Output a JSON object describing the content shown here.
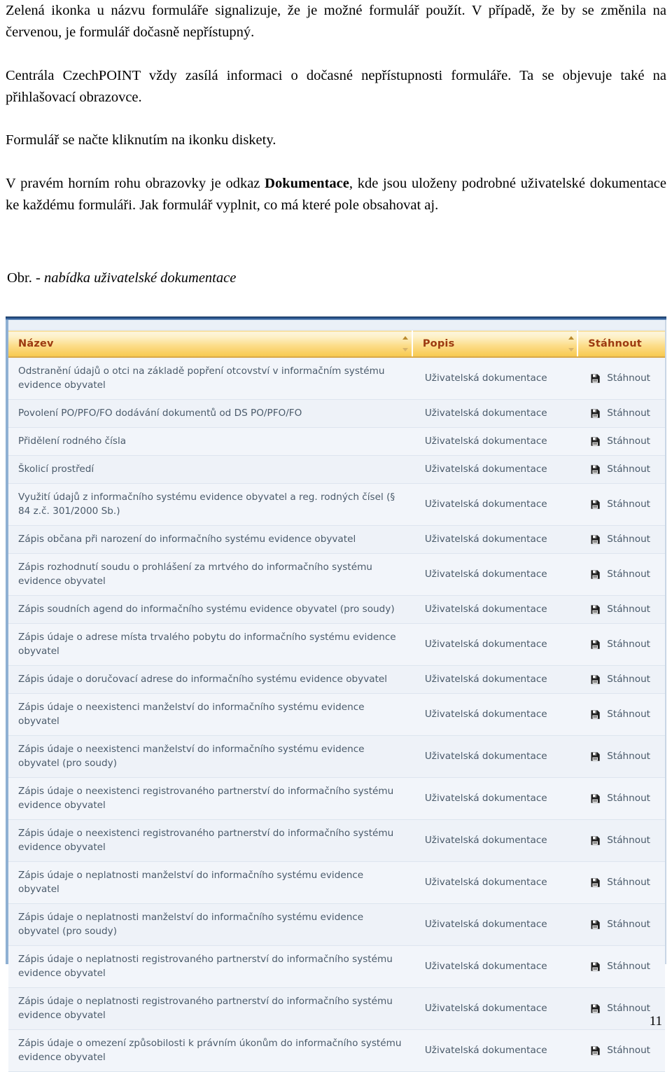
{
  "document": {
    "page_number": "11",
    "paragraphs": [
      "Zelená ikonka u názvu formuláře signalizuje, že je možné formulář použít. V případě, že by se změnila na červenou, je formulář dočasně nepřístupný.",
      "Centrála CzechPOINT vždy zasílá informaci o dočasné nepřístupnosti formuláře. Ta se objevuje také na přihlašovací obrazovce.",
      "Formulář se načte kliknutím na ikonku diskety."
    ],
    "paragraph_4": {
      "before": "V pravém horním rohu obrazovky je odkaz ",
      "bold": "Dokumentace",
      "after": ", kde jsou uloženy podrobné uživatelské dokumentace ke každému formuláři. Jak formulář vyplnit, co má které pole obsahovat aj."
    },
    "figure_caption": {
      "label": "Obr. ",
      "italic": "- nabídka uživatelské dokumentace"
    }
  },
  "screenshot": {
    "table": {
      "columns": [
        {
          "key": "name",
          "label": "Název",
          "sortable": true
        },
        {
          "key": "desc",
          "label": "Popis",
          "sortable": true
        },
        {
          "key": "download",
          "label": "Stáhnout",
          "sortable": false
        }
      ],
      "download_label": "Stáhnout",
      "download_icon": "floppy-disk-icon",
      "rows": [
        {
          "name": "Odstranění údajů o otci na základě popření otcovství v informačním systému evidence obyvatel",
          "desc": "Uživatelská dokumentace",
          "download": "Stáhnout"
        },
        {
          "name": "Povolení PO/PFO/FO dodávání dokumentů od DS PO/PFO/FO",
          "desc": "Uživatelská dokumentace",
          "download": "Stáhnout"
        },
        {
          "name": "Přidělení rodného čísla",
          "desc": "Uživatelská dokumentace",
          "download": "Stáhnout"
        },
        {
          "name": "Školicí prostředí",
          "desc": "Uživatelská dokumentace",
          "download": "Stáhnout"
        },
        {
          "name": "Využití údajů z informačního systému evidence obyvatel a reg. rodných čísel (§ 84 z.č. 301/2000 Sb.)",
          "desc": "Uživatelská dokumentace",
          "download": "Stáhnout"
        },
        {
          "name": "Zápis občana při narození do informačního systému evidence obyvatel",
          "desc": "Uživatelská dokumentace",
          "download": "Stáhnout"
        },
        {
          "name": "Zápis rozhodnutí soudu o prohlášení za mrtvého do informačního systému evidence obyvatel",
          "desc": "Uživatelská dokumentace",
          "download": "Stáhnout"
        },
        {
          "name": "Zápis soudních agend do informačního systému evidence obyvatel (pro soudy)",
          "desc": "Uživatelská dokumentace",
          "download": "Stáhnout"
        },
        {
          "name": "Zápis údaje o adrese místa trvalého pobytu do informačního systému evidence obyvatel",
          "desc": "Uživatelská dokumentace",
          "download": "Stáhnout"
        },
        {
          "name": "Zápis údaje o doručovací adrese do informačního systému evidence obyvatel",
          "desc": "Uživatelská dokumentace",
          "download": "Stáhnout"
        },
        {
          "name": "Zápis údaje o neexistenci manželství do informačního systému evidence obyvatel",
          "desc": "Uživatelská dokumentace",
          "download": "Stáhnout"
        },
        {
          "name": "Zápis údaje o neexistenci manželství do informačního systému evidence obyvatel (pro soudy)",
          "desc": "Uživatelská dokumentace",
          "download": "Stáhnout"
        },
        {
          "name": "Zápis údaje o neexistenci registrovaného partnerství do informačního systému evidence obyvatel",
          "desc": "Uživatelská dokumentace",
          "download": "Stáhnout"
        },
        {
          "name": "Zápis údaje o neexistenci registrovaného partnerství do informačního systému evidence obyvatel",
          "desc": "Uživatelská dokumentace",
          "download": "Stáhnout"
        },
        {
          "name": "Zápis údaje o neplatnosti manželství do informačního systému evidence obyvatel",
          "desc": "Uživatelská dokumentace",
          "download": "Stáhnout"
        },
        {
          "name": "Zápis údaje o neplatnosti manželství do informačního systému evidence obyvatel (pro soudy)",
          "desc": "Uživatelská dokumentace",
          "download": "Stáhnout"
        },
        {
          "name": "Zápis údaje o neplatnosti registrovaného partnerství do informačního systému evidence obyvatel",
          "desc": "Uživatelská dokumentace",
          "download": "Stáhnout"
        },
        {
          "name": "Zápis údaje o neplatnosti registrovaného partnerství do informačního systému evidence obyvatel",
          "desc": "Uživatelská dokumentace",
          "download": "Stáhnout"
        },
        {
          "name": "Zápis údaje o omezení způsobilosti k právním úkonům do informačního systému evidence obyvatel",
          "desc": "Uživatelská dokumentace",
          "download": "Stáhnout"
        }
      ]
    },
    "colors": {
      "header_gradient_top": "#fdf6e0",
      "header_gradient_bottom": "#f6c94f",
      "header_text": "#9c3a10",
      "row_bg": "#f2f5fa",
      "row_alt_bg": "#eef2f8",
      "row_text": "#4a5a6a",
      "top_border": "#17365d",
      "left_border": "#8fb0d3"
    }
  }
}
